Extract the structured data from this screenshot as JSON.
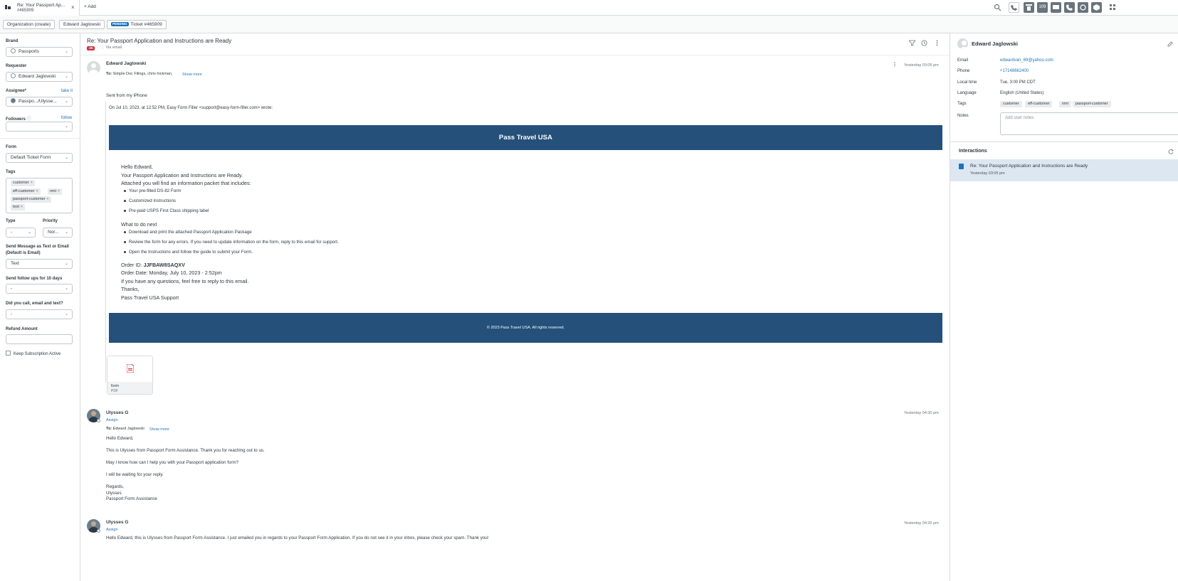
{
  "topbar": {
    "tab_title": "Re: Your Passport Ap...",
    "tab_subtitle": "#465909",
    "add_label": "Add",
    "status_count": "109"
  },
  "breadcrumbs": {
    "organization": "Organization (create)",
    "requester": "Edward Jaglowski",
    "status_badge": "PENDING",
    "ticket": "Ticket #465909"
  },
  "ticket_fields": {
    "brand_label": "Brand",
    "brand_value": "Passports",
    "requester_label": "Requester",
    "requester_value": "Edward Jaglowski",
    "assignee_label": "Assignee*",
    "take_it": "take it",
    "assignee_value": "Passpo.../Ulysse...",
    "followers_label": "Followers",
    "follow": "follow",
    "form_label": "Form",
    "form_value": "Default Ticket Form",
    "tags_label": "Tags",
    "tags": [
      "customer",
      "eff-customer",
      "nmi",
      "passport-customer",
      "text"
    ],
    "type_label": "Type",
    "type_value": "-",
    "priority_label": "Priority",
    "priority_value": "Nor...",
    "send_msg_label_1": "Send Message as Text or Email",
    "send_msg_label_2": "(Default is Email)",
    "send_msg_value": "Text",
    "followups_label": "Send follow ups for 10 days",
    "followups_value": "-",
    "call_label": "Did you call, email and text?",
    "call_value": "-",
    "refund_label": "Refund Amount",
    "keep_sub_label": "Keep Subscription Active"
  },
  "conversation": {
    "subject": "Re: Your Passport Application and Instructions are Ready",
    "age_badge": "-2h",
    "via": "Via email",
    "messages": [
      {
        "author": "Edward Jaglowski",
        "timestamp": "Yesterday 03:05 pm",
        "to_label": "To:",
        "to": "Simple Doc Filings, chris hickman,",
        "show_more": "Show more",
        "sent_from": "Sent from my iPhone",
        "quote_header": "On Jul 10, 2023, at 12:52 PM, Easy Form Filler <support@easy-form-filler.com> wrote:"
      },
      {
        "author": "Ulysses G",
        "assign": "Assign",
        "timestamp": "Yesterday 04:30 pm",
        "to_label": "To:",
        "to": "Edward Jaglowski",
        "show_more": "Show more",
        "lines": [
          "Hello Edward,",
          "This is Ulysses from Passport Form Assistance. Thank you for reaching out to us.",
          "May I know how can I help you with your Passport application form?",
          "I will be waiting for your reply.",
          "Regards,",
          "Ulysses",
          "Passport Form Assistance"
        ]
      },
      {
        "author": "Ulysses G",
        "assign": "Assign",
        "timestamp": "Yesterday 04:30 pm",
        "text": "Hello Edward, this is Ulysses from Passport Form Assistance. I just emailed you in regards to your Passport Form Application. If you do not see it in your inbox, please check your spam. Thank you!"
      }
    ]
  },
  "email": {
    "banner_title": "Pass Travel USA",
    "greeting": "Hello Edward,",
    "line1": "Your Passport Application and Instructions are Ready.",
    "line2": "Attached you will find an information packet that includes:",
    "packet_items": [
      "Your pre-filled DS-82 Form",
      "Customized Instructions",
      "Pre-paid USPS First Class shipping label"
    ],
    "next_heading": "What to do next",
    "next_items": [
      "Download and print the attached Passport Application Package",
      "Review the form for any errors. If you need to update information on the form, reply to this email for support.",
      "Open the Instructions and follow the guide to submit your Form."
    ],
    "order_id_label": "Order ID:",
    "order_id": "JJFBAW8SAQXV",
    "order_date": "Order Date: Monday, July 10, 2023 - 2:52pm",
    "questions": "If you have any questions, feel free to reply to this email.",
    "thanks": "Thanks,",
    "signature": "Pass Travel USA Support",
    "footer": "© 2023 Pass Travel USA. All rights reserved."
  },
  "attachment": {
    "name": "form",
    "type": "PDF"
  },
  "user_panel": {
    "name": "Edward Jaglowski",
    "email_label": "Email",
    "email": "edwardvan_69@yahoo.com",
    "phone_label": "Phone",
    "phone": "+17148662400",
    "local_time_label": "Local time",
    "local_time": "Tue, 3:00 PM CDT",
    "language_label": "Language",
    "language": "English (United States)",
    "tags_label": "Tags",
    "tags": [
      "customer",
      "eff-customer",
      "nmi",
      "passport-customer"
    ],
    "notes_label": "Notes",
    "notes_placeholder": "Add user notes"
  },
  "interactions": {
    "title": "Interactions",
    "items": [
      {
        "title": "Re: Your Passport Application and Instructions are Ready",
        "time": "Yesterday 03:05 pm"
      }
    ]
  },
  "colors": {
    "banner": "#24507a",
    "link": "#1f73b7",
    "pending": "#1f73b7",
    "urgent": "#cc3340",
    "selected": "#dde7f1"
  }
}
